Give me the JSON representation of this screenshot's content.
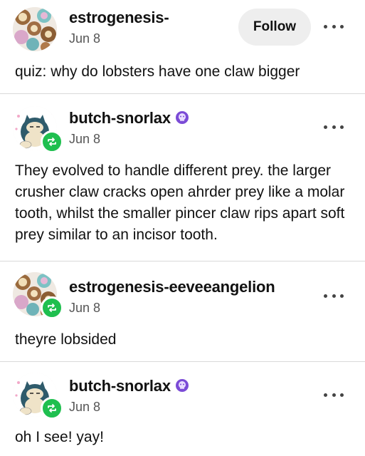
{
  "posts": [
    {
      "username": "estrogenesis-",
      "date": "Jun 8",
      "follow_label": "Follow",
      "text": "quiz: why do lobsters have one claw bigger",
      "avatar_icon": "eevee-collage-icon"
    },
    {
      "username": "butch-snorlax",
      "date": "Jun 8",
      "text": "They evolved to handle different prey. the larger crusher claw cracks open ahrder prey like a molar tooth, whilst the smaller pincer claw rips apart soft prey similar to an incisor tooth.",
      "avatar_icon": "snorlax-icon",
      "badge_icon": "reblog-icon",
      "verified_icon": "purple-badge-icon"
    },
    {
      "username": "estrogenesis-eeveeangelion",
      "date": "Jun 8",
      "text": "theyre lobsided",
      "avatar_icon": "eevee-collage-icon",
      "badge_icon": "reblog-icon"
    },
    {
      "username": "butch-snorlax",
      "date": "Jun 8",
      "text": "oh I see! yay!",
      "avatar_icon": "snorlax-icon",
      "badge_icon": "reblog-icon",
      "verified_icon": "purple-badge-icon"
    }
  ],
  "colors": {
    "reblog_green": "#1fbf4f",
    "verified_purple": "#7b4bd6",
    "follow_bg": "#eeeeee"
  }
}
